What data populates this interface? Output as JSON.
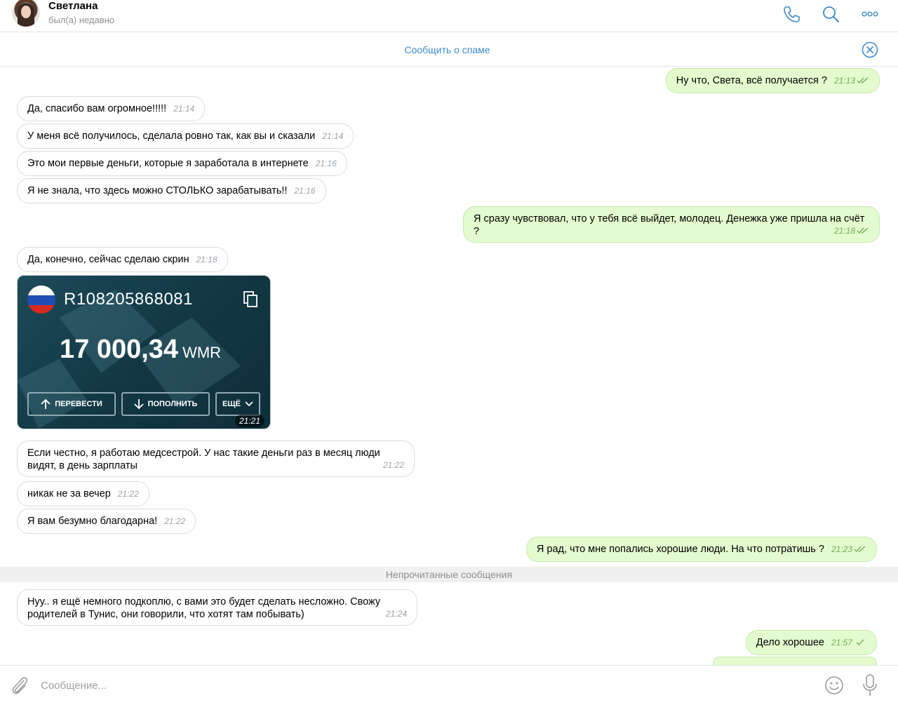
{
  "header": {
    "name": "Светлана",
    "status": "был(а) недавно",
    "icons": [
      "phone-icon",
      "search-icon",
      "more-icon"
    ]
  },
  "spam_bar": {
    "label": "Сообщить о спаме"
  },
  "messages": [
    {
      "text": "Ну что, Света, всё получается ?",
      "time": "21:13",
      "direction": "out"
    },
    {
      "text": "Да, спасибо вам огромное!!!!!",
      "time": "21:14",
      "direction": "in"
    },
    {
      "text": "У меня всё получилось, сделала ровно так, как вы и сказали",
      "time": "21:14",
      "direction": "in"
    },
    {
      "text": "Это мои первые деньги, которые я заработала в интернете",
      "time": "21:16",
      "direction": "in"
    },
    {
      "text": "Я не знала, что здесь можно СТОЛЬКО зарабатывать!!",
      "time": "21:16",
      "direction": "in"
    },
    {
      "text": "Я сразу чувствовал, что у тебя всё выйдет, молодец. Денежка уже пришла на счёт ?",
      "time": "21:18",
      "direction": "out"
    },
    {
      "text": "Да, конечно, сейчас сделаю скрин",
      "time": "21:18",
      "direction": "in"
    },
    {
      "text": "Если честно, я работаю медсестрой. У нас такие деньги раз в месяц люди видят, в день зарплаты",
      "time": "21:22",
      "direction": "in"
    },
    {
      "text": "никак не за вечер",
      "time": "21:22",
      "direction": "in"
    },
    {
      "text": "Я вам безумно благодарна!",
      "time": "21:22",
      "direction": "in"
    },
    {
      "text": "Я рад, что мне попались хорошие люди. На что потратишь ?",
      "time": "21:23",
      "direction": "out"
    },
    {
      "text": "Нуу.. я ещё немного подкоплю, с вами это будет сделать несложно. Свожу родителей в Тунис, они говорили, что хотят там побывать)",
      "time": "21:24",
      "direction": "in"
    },
    {
      "text": "Дело хорошее",
      "time": "21:57",
      "direction": "out"
    }
  ],
  "image_card": {
    "account": "R108205868081",
    "amount": "17 000,34",
    "currency": "WMR",
    "buttons": [
      "ПЕРЕВЕСТИ",
      "ПОПОЛНИТЬ",
      "ЕЩЁ"
    ],
    "time": "21:21"
  },
  "unread_divider": "Непрочитанные сообщения",
  "input": {
    "placeholder": "Сообщение..."
  },
  "colors": {
    "accent": "#3e8bcb",
    "outgoing_bubble": "#e3fbce",
    "incoming_bubble": "#ffffff"
  }
}
